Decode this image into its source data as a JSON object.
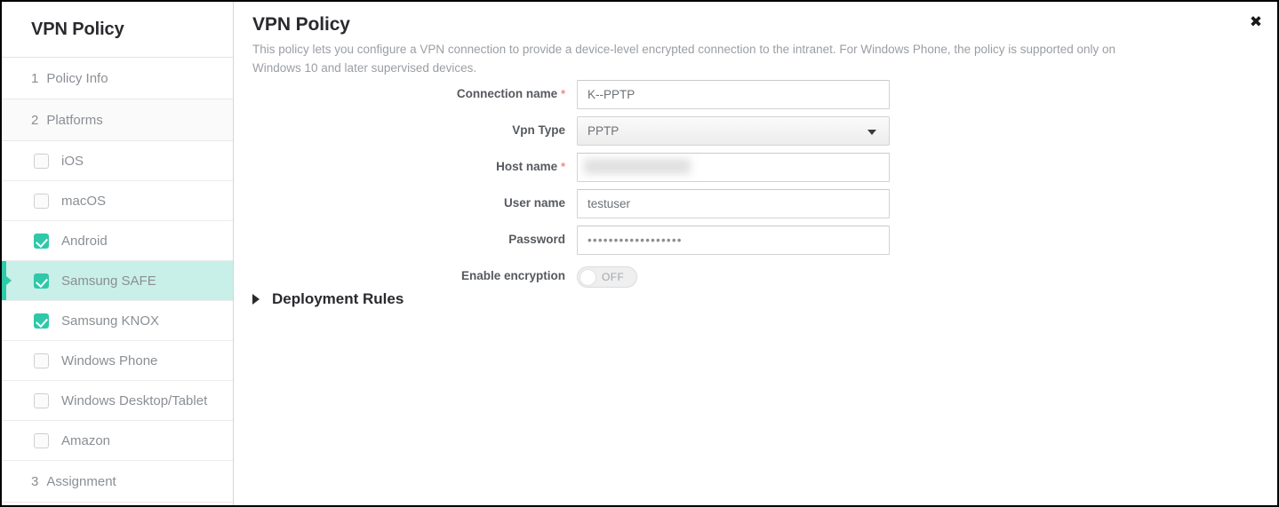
{
  "sidebar": {
    "title": "VPN Policy",
    "steps": [
      {
        "num": "1",
        "label": "Policy Info"
      },
      {
        "num": "2",
        "label": "Platforms"
      }
    ],
    "platforms": [
      {
        "label": "iOS",
        "checked": false,
        "active": false
      },
      {
        "label": "macOS",
        "checked": false,
        "active": false
      },
      {
        "label": "Android",
        "checked": true,
        "active": false
      },
      {
        "label": "Samsung SAFE",
        "checked": true,
        "active": true
      },
      {
        "label": "Samsung KNOX",
        "checked": true,
        "active": false
      },
      {
        "label": "Windows Phone",
        "checked": false,
        "active": false
      },
      {
        "label": "Windows Desktop/Tablet",
        "checked": false,
        "active": false
      },
      {
        "label": "Amazon",
        "checked": false,
        "active": false
      }
    ],
    "assignment": {
      "num": "3",
      "label": "Assignment"
    }
  },
  "main": {
    "title": "VPN Policy",
    "description": "This policy lets you configure a VPN connection to provide a device-level encrypted connection to the intranet. For Windows Phone, the policy is supported only on Windows 10 and later supervised devices.",
    "close_label": "✖",
    "required_marker": "*",
    "fields": {
      "connection_name": {
        "label": "Connection name",
        "value": "K--PPTP",
        "required": true
      },
      "vpn_type": {
        "label": "Vpn Type",
        "value": "PPTP",
        "required": false
      },
      "host_name": {
        "label": "Host name",
        "value": "",
        "required": true,
        "redacted": true
      },
      "user_name": {
        "label": "User name",
        "value": "testuser",
        "required": false
      },
      "password": {
        "label": "Password",
        "value": "••••••••••••••••••",
        "required": false
      },
      "enable_encryption": {
        "label": "Enable encryption",
        "state": "OFF"
      }
    },
    "deployment_rules": {
      "label": "Deployment Rules",
      "expanded": false
    }
  },
  "colors": {
    "accent": "#2fc8a8",
    "accent_bg": "#c8efe8",
    "required": "#f08a84",
    "text_dark": "#2a2a2e",
    "text_muted": "#9a9ea3"
  }
}
